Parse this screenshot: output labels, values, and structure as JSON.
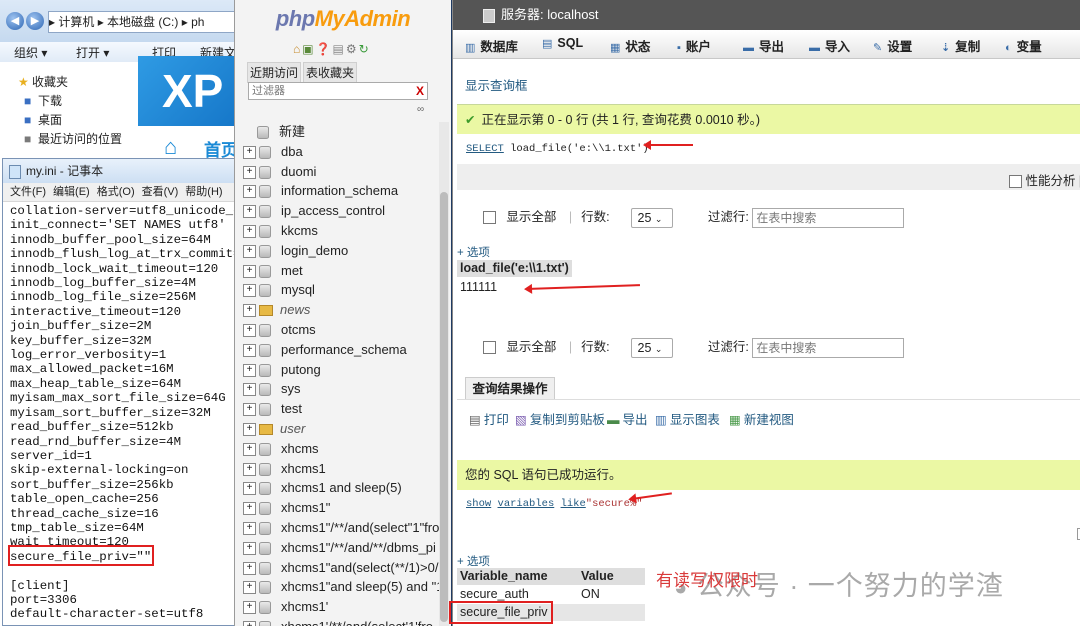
{
  "explorer": {
    "address": "▸ 计算机 ▸ 本地磁盘 (C:) ▸ ph",
    "toolbar": [
      "组织 ▾",
      "打开 ▾",
      "打印",
      "新建文"
    ],
    "favorites": [
      "收藏夹",
      "下载",
      "桌面",
      "最近访问的位置"
    ],
    "banner_text": "XP",
    "banner_sub": "首页"
  },
  "notepad": {
    "title": "my.ini - 记事本",
    "menu": [
      "文件(F)",
      "编辑(E)",
      "格式(O)",
      "查看(V)",
      "帮助(H)"
    ],
    "lines": [
      "collation-server=utf8_unicode_c",
      "init_connect='SET NAMES utf8'",
      "innodb_buffer_pool_size=64M",
      "innodb_flush_log_at_trx_commit=",
      "innodb_lock_wait_timeout=120",
      "innodb_log_buffer_size=4M",
      "innodb_log_file_size=256M",
      "interactive_timeout=120",
      "join_buffer_size=2M",
      "key_buffer_size=32M",
      "log_error_verbosity=1",
      "max_allowed_packet=16M",
      "max_heap_table_size=64M",
      "myisam_max_sort_file_size=64G",
      "myisam_sort_buffer_size=32M",
      "read_buffer_size=512kb",
      "read_rnd_buffer_size=4M",
      "server_id=1",
      "skip-external-locking=on",
      "sort_buffer_size=256kb",
      "table_open_cache=256",
      "thread_cache_size=16",
      "tmp_table_size=64M",
      "wait_timeout=120",
      "secure_file_priv=\"\"",
      "",
      "[client]",
      "port=3306",
      "default-character-set=utf8"
    ]
  },
  "pma_nav": {
    "logo_php": "php",
    "logo_admin": "MyAdmin",
    "tabs": [
      "近期访问",
      "表收藏夹"
    ],
    "filter_placeholder": "过滤器",
    "filter_clear": "X",
    "new_label": "新建",
    "databases": [
      {
        "name": "dba",
        "italic": false
      },
      {
        "name": "duomi",
        "italic": false
      },
      {
        "name": "information_schema",
        "italic": false
      },
      {
        "name": "ip_access_control",
        "italic": false
      },
      {
        "name": "kkcms",
        "italic": false
      },
      {
        "name": "login_demo",
        "italic": false
      },
      {
        "name": "met",
        "italic": false
      },
      {
        "name": "mysql",
        "italic": false
      },
      {
        "name": "news",
        "italic": true
      },
      {
        "name": "otcms",
        "italic": false
      },
      {
        "name": "performance_schema",
        "italic": false
      },
      {
        "name": "putong",
        "italic": false
      },
      {
        "name": "sys",
        "italic": false
      },
      {
        "name": "test",
        "italic": false
      },
      {
        "name": "user",
        "italic": true
      },
      {
        "name": "xhcms",
        "italic": false
      },
      {
        "name": "xhcms1",
        "italic": false
      },
      {
        "name": "xhcms1 and sleep(5)",
        "italic": false
      },
      {
        "name": "xhcms1\"",
        "italic": false
      },
      {
        "name": "xhcms1\"/**/and(select\"1\"fro",
        "italic": false
      },
      {
        "name": "xhcms1\"/**/and/**/dbms_pi",
        "italic": false
      },
      {
        "name": "xhcms1\"and(select(**/1)>0/",
        "italic": false
      },
      {
        "name": "xhcms1\"and sleep(5) and \"1",
        "italic": false
      },
      {
        "name": "xhcms1'",
        "italic": false
      },
      {
        "name": "xhcms1'/**/and(select'1'fro",
        "italic": false
      }
    ]
  },
  "pma_main": {
    "server_title": "服务器: localhost",
    "tabs": [
      "数据库",
      "SQL",
      "状态",
      "账户",
      "导出",
      "导入",
      "设置",
      "复制",
      "变量"
    ],
    "show_query_box": "显示查询框",
    "query1": {
      "success_msg": "正在显示第 0 - 0 行 (共 1 行, 查询花费 0.0010 秒。)",
      "sql_keyword": "SELECT",
      "sql_rest": " load_file('e:\\\\1.txt')",
      "profiling": "性能分析 [",
      "show_all": "显示全部",
      "rows_label": "行数:",
      "rows_value": "25",
      "filter_rows_label": "过滤行:",
      "filter_placeholder": "在表中搜索",
      "options_link": "+ 选项",
      "column_header": "load_file('e:\\\\1.txt')",
      "value": "111111"
    },
    "result_ops": {
      "title": "查询结果操作",
      "actions": [
        "打印",
        "复制到剪贴板",
        "导出",
        "显示图表",
        "新建视图"
      ]
    },
    "query2": {
      "success_msg": "您的 SQL 语句已成功运行。",
      "sql_parts": [
        "show",
        " ",
        "variables",
        " ",
        "like",
        "\"secure%\""
      ],
      "options_link": "+ 选项",
      "col_name": "Variable_name",
      "col_value": "Value",
      "rows": [
        {
          "name": "secure_auth",
          "value": "ON"
        },
        {
          "name": "secure_file_priv",
          "value": ""
        }
      ]
    }
  },
  "overlays": {
    "annotation": "有读写权限时",
    "watermark": "公众号 · 一个努力的学渣",
    "accent_red": "#e02020"
  }
}
